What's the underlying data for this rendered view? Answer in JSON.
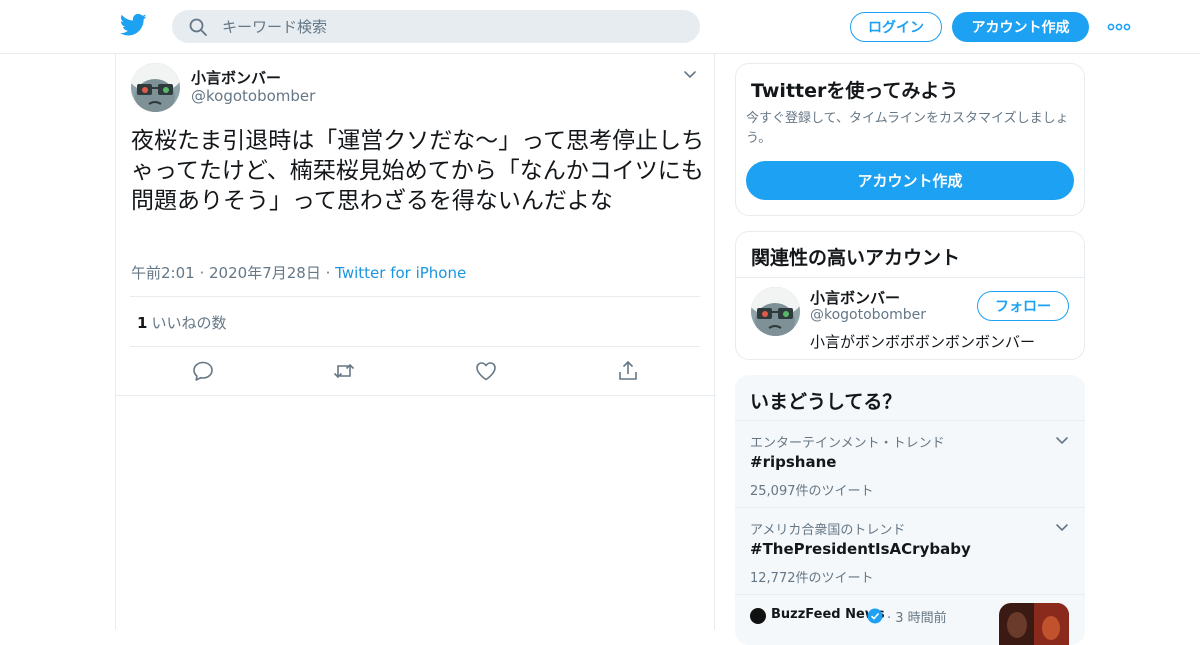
{
  "header": {
    "search_placeholder": "キーワード検索",
    "login_label": "ログイン",
    "signup_label": "アカウント作成"
  },
  "tweet": {
    "author_name": "小言ボンバー",
    "author_handle": "@kogotobomber",
    "text": "夜桜たま引退時は「運営クソだな〜」って思考停止しちゃってたけど、楠栞桜見始めてから「なんかコイツにも問題ありそう」って思わざるを得ないんだよな",
    "time": "午前2:01",
    "date": "2020年7月28日",
    "source": "Twitter for iPhone",
    "likes_count": "1",
    "likes_label": "いいねの数"
  },
  "signup_card": {
    "title": "Twitterを使ってみよう",
    "description": "今すぐ登録して、タイムラインをカスタマイズしましょう。",
    "button_label": "アカウント作成"
  },
  "related_card": {
    "title": "関連性の高いアカウント",
    "account_name": "小言ボンバー",
    "account_handle": "@kogotobomber",
    "account_bio": "小言がボンボボボンボンボンバー",
    "follow_label": "フォロー"
  },
  "trends_card": {
    "title": "いまどうしてる？",
    "trends": [
      {
        "category": "エンターテインメント・トレンド",
        "name": "#ripshane",
        "count": "25,097件のツイート"
      },
      {
        "category": "アメリカ合衆国のトレンド",
        "name": "#ThePresidentIsACrybaby",
        "count": "12,772件のツイート"
      }
    ],
    "news": {
      "source": "BuzzFeed News",
      "time": "3 時間前"
    }
  },
  "colors": {
    "accent": "#1da1f2",
    "link": "#1b95e0",
    "secondary_text": "#657786",
    "border": "#e6ecf0"
  }
}
